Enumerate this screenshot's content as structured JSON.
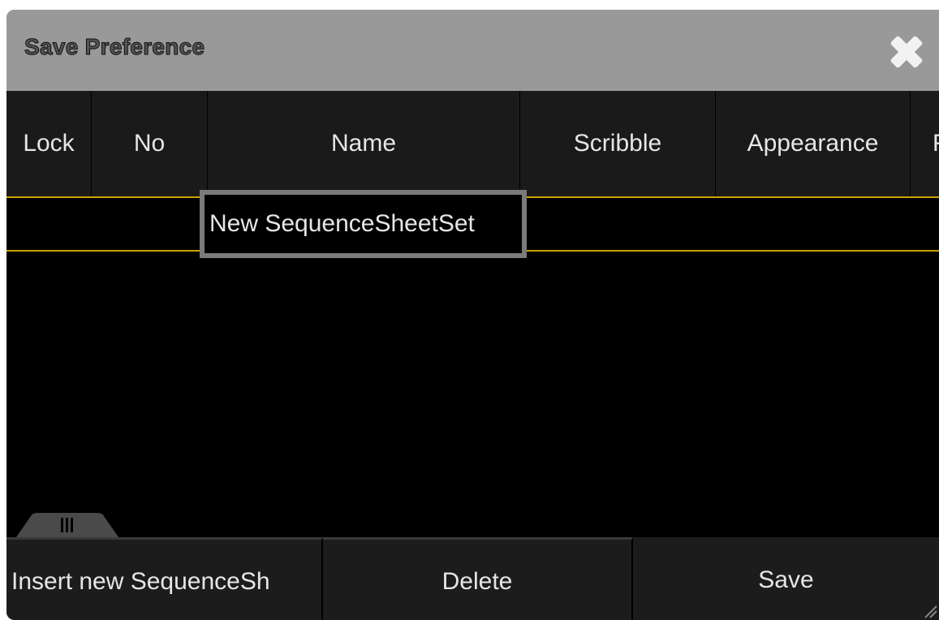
{
  "dialog": {
    "title": "Save Preference",
    "close_icon": "close-icon"
  },
  "table": {
    "columns": [
      "Lock",
      "No",
      "Name",
      "Scribble",
      "Appearance",
      "F"
    ],
    "rows": [
      {
        "lock": "",
        "no": "",
        "name": "New SequenceSheetSet",
        "scribble": "",
        "appearance": ""
      }
    ]
  },
  "buttons": {
    "insert": "Insert new SequenceSh",
    "delete": "Delete",
    "save": "Save"
  },
  "colors": {
    "title_bar": "#999999",
    "selection_line": "#c9a400",
    "edit_border": "#7a7a7a",
    "background": "#000000"
  }
}
